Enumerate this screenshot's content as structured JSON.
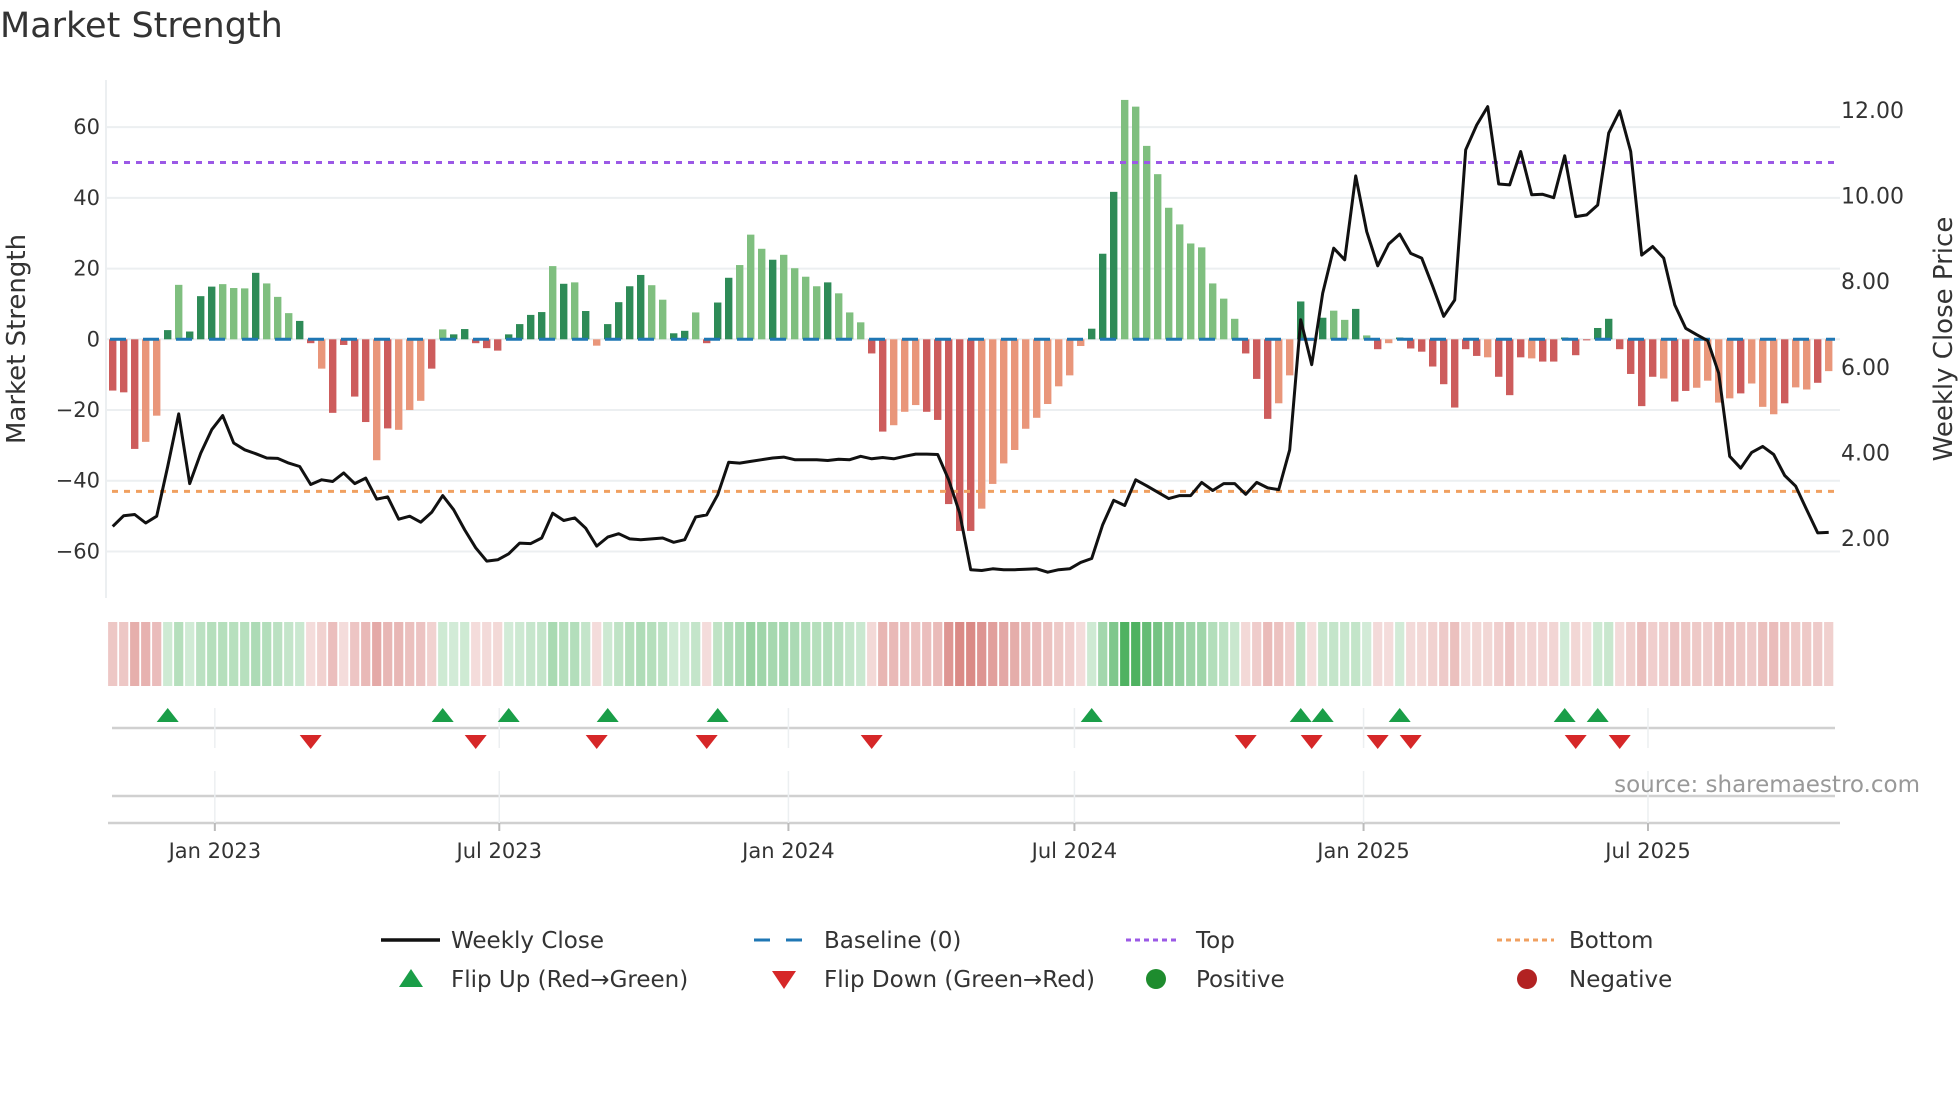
{
  "title": "Market Strength",
  "source": "source: sharemaestro.com",
  "chart_data": {
    "type": "bar+line",
    "title": "Market Strength",
    "ylabel": "Market Strength",
    "y2label": "Weekly Close Price",
    "ylim": [
      -73,
      73
    ],
    "y2lim": [
      0.6,
      12.7
    ],
    "x_start": "2022-10-28",
    "x_step_days": 7,
    "yticks": [
      60,
      40,
      20,
      0,
      -20,
      -40,
      -60
    ],
    "yticks_labels": [
      "60",
      "40",
      "20",
      "0",
      "−20",
      "−40",
      "−60"
    ],
    "y2ticks": [
      12,
      10,
      8,
      6,
      4,
      2
    ],
    "y2ticks_labels": [
      "12.00",
      "10.00",
      "8.00",
      "6.00",
      "4.00",
      "2.00"
    ],
    "xticks": [
      {
        "date": "2023-01-01",
        "label": "Jan 2023"
      },
      {
        "date": "2023-07-01",
        "label": "Jul 2023"
      },
      {
        "date": "2024-01-01",
        "label": "Jan 2024"
      },
      {
        "date": "2024-07-01",
        "label": "Jul 2024"
      },
      {
        "date": "2025-01-01",
        "label": "Jan 2025"
      },
      {
        "date": "2025-07-01",
        "label": "Jul 2025"
      }
    ],
    "top_level": 50,
    "bottom_level": -43,
    "baseline": 0,
    "strength": [
      -14.5,
      -15,
      -31,
      -29,
      -21.6,
      2.6,
      15.4,
      2.2,
      12.2,
      14.9,
      15.6,
      14.5,
      14.4,
      18.8,
      15.8,
      12,
      7.4,
      5.2,
      -1.1,
      -8.3,
      -20.8,
      -1.6,
      -16.2,
      -23.4,
      -34.2,
      -25.2,
      -25.6,
      -20,
      -17.4,
      -8.3,
      2.8,
      1.4,
      2.9,
      -1.1,
      -2.5,
      -3.2,
      1.4,
      4.3,
      6.9,
      7.7,
      20.7,
      15.7,
      16.1,
      8,
      -1.8,
      4.3,
      10.5,
      15,
      18.2,
      15.3,
      11.2,
      1.7,
      2.4,
      7.6,
      -1.1,
      10.4,
      17.4,
      21,
      29.6,
      25.6,
      22.5,
      23.9,
      20.1,
      17.7,
      15,
      16.1,
      13,
      7.6,
      4.8,
      -4,
      -26.1,
      -24.3,
      -20.5,
      -18.6,
      -20.5,
      -22.8,
      -46.6,
      -54.2,
      -54.2,
      -47.9,
      -40.9,
      -35.1,
      -31.3,
      -25.3,
      -22.2,
      -18.3,
      -13.3,
      -10.2,
      -1.9,
      3,
      24.2,
      41.7,
      67.7,
      65.8,
      54.7,
      46.7,
      37.2,
      32.5,
      27.1,
      26,
      15.8,
      11.5,
      5.8,
      -4,
      -11.2,
      -22.5,
      -18.1,
      -10.2,
      10.7,
      -0.5,
      6.1,
      8.1,
      5.5,
      8.6,
      1.1,
      -2.8,
      -1.1,
      0.5,
      -2.6,
      -3.5,
      -7.7,
      -12.7,
      -19.3,
      -2.8,
      -4.7,
      -5.1,
      -10.6,
      -15.8,
      -5.1,
      -5.4,
      -6.3,
      -6.3,
      0.5,
      -4.5,
      -0.3,
      3.2,
      5.8,
      -2.8,
      -9.8,
      -18.9,
      -10.6,
      -11.1,
      -17.6,
      -14.6,
      -13.7,
      -11.7,
      -17.9,
      -16.7,
      -15.3,
      -12.5,
      -19.1,
      -21.2,
      -18.1,
      -13.6,
      -14.2,
      -12.3,
      -9
    ],
    "strength_shade": "dddlldldddllldlllddlddddldllldldddddddddldldlddddllddldddllldlllldlllddllldddddlllllllllldddllllllllllldddlldldlldldlddddddddldddldddddddddddlddlllldllldlldl",
    "weekly_close": [
      2.27,
      2.52,
      2.55,
      2.35,
      2.51,
      3.67,
      4.9,
      3.27,
      3.98,
      4.53,
      4.86,
      4.22,
      4.06,
      3.97,
      3.87,
      3.86,
      3.75,
      3.67,
      3.25,
      3.36,
      3.32,
      3.52,
      3.27,
      3.4,
      2.91,
      2.96,
      2.44,
      2.51,
      2.37,
      2.6,
      2.99,
      2.66,
      2.19,
      1.77,
      1.46,
      1.49,
      1.63,
      1.88,
      1.87,
      2.0,
      2.58,
      2.41,
      2.47,
      2.23,
      1.81,
      2.02,
      2.1,
      1.98,
      1.96,
      1.98,
      2.0,
      1.9,
      1.96,
      2.49,
      2.54,
      3.01,
      3.77,
      3.75,
      3.79,
      3.83,
      3.87,
      3.89,
      3.83,
      3.83,
      3.83,
      3.81,
      3.84,
      3.83,
      3.91,
      3.85,
      3.88,
      3.85,
      3.91,
      3.96,
      3.96,
      3.95,
      3.36,
      2.58,
      1.26,
      1.24,
      1.28,
      1.26,
      1.26,
      1.27,
      1.28,
      1.2,
      1.26,
      1.28,
      1.43,
      1.52,
      2.31,
      2.88,
      2.76,
      3.36,
      3.22,
      3.07,
      2.92,
      2.99,
      2.99,
      3.3,
      3.11,
      3.27,
      3.27,
      3.02,
      3.3,
      3.17,
      3.13,
      4.06,
      7.1,
      6.05,
      7.72,
      8.77,
      8.5,
      10.46,
      9.16,
      8.36,
      8.87,
      9.1,
      8.65,
      8.54,
      7.88,
      7.18,
      7.56,
      11.07,
      11.65,
      12.08,
      10.27,
      10.25,
      11.03,
      10.02,
      10.03,
      9.95,
      10.93,
      9.51,
      9.55,
      9.78,
      11.46,
      11.98,
      11.03,
      8.61,
      8.81,
      8.54,
      7.45,
      6.9,
      6.75,
      6.61,
      5.85,
      3.91,
      3.63,
      4.0,
      4.14,
      3.95,
      3.46,
      3.21,
      2.66,
      2.12,
      2.13
    ],
    "flip_up_weeks": [
      5,
      30,
      36,
      45,
      55,
      89,
      108,
      110,
      117,
      132,
      135
    ],
    "flip_down_weeks": [
      18,
      33,
      44,
      54,
      69,
      103,
      109,
      115,
      118,
      133,
      137
    ],
    "legend": [
      {
        "label": "Weekly Close",
        "icon": "solid-line"
      },
      {
        "label": "Baseline (0)",
        "icon": "dashed-line"
      },
      {
        "label": "Top",
        "icon": "dotted-line-purple"
      },
      {
        "label": "Bottom",
        "icon": "dotted-line-orange"
      },
      {
        "label": "Flip Up (Red→Green)",
        "icon": "triangle-up"
      },
      {
        "label": "Flip Down (Green→Red)",
        "icon": "triangle-down"
      },
      {
        "label": "Positive",
        "icon": "circle-green"
      },
      {
        "label": "Negative",
        "icon": "circle-red"
      }
    ],
    "legend_placement": "bottom"
  },
  "colors": {
    "pos_dark": "#2e8b57",
    "pos_light": "#7fbf7f",
    "neg_dark": "#cd5c5c",
    "neg_light": "#e9967a",
    "close": "#111111",
    "baseline": "#1f77b4",
    "top": "#9b59e6",
    "bottom": "#f0a060",
    "flip_up": "#1a9e48",
    "flip_down": "#d62728",
    "positive": "#1e8c2e",
    "negative": "#b22222",
    "grid": "#eceff1"
  }
}
